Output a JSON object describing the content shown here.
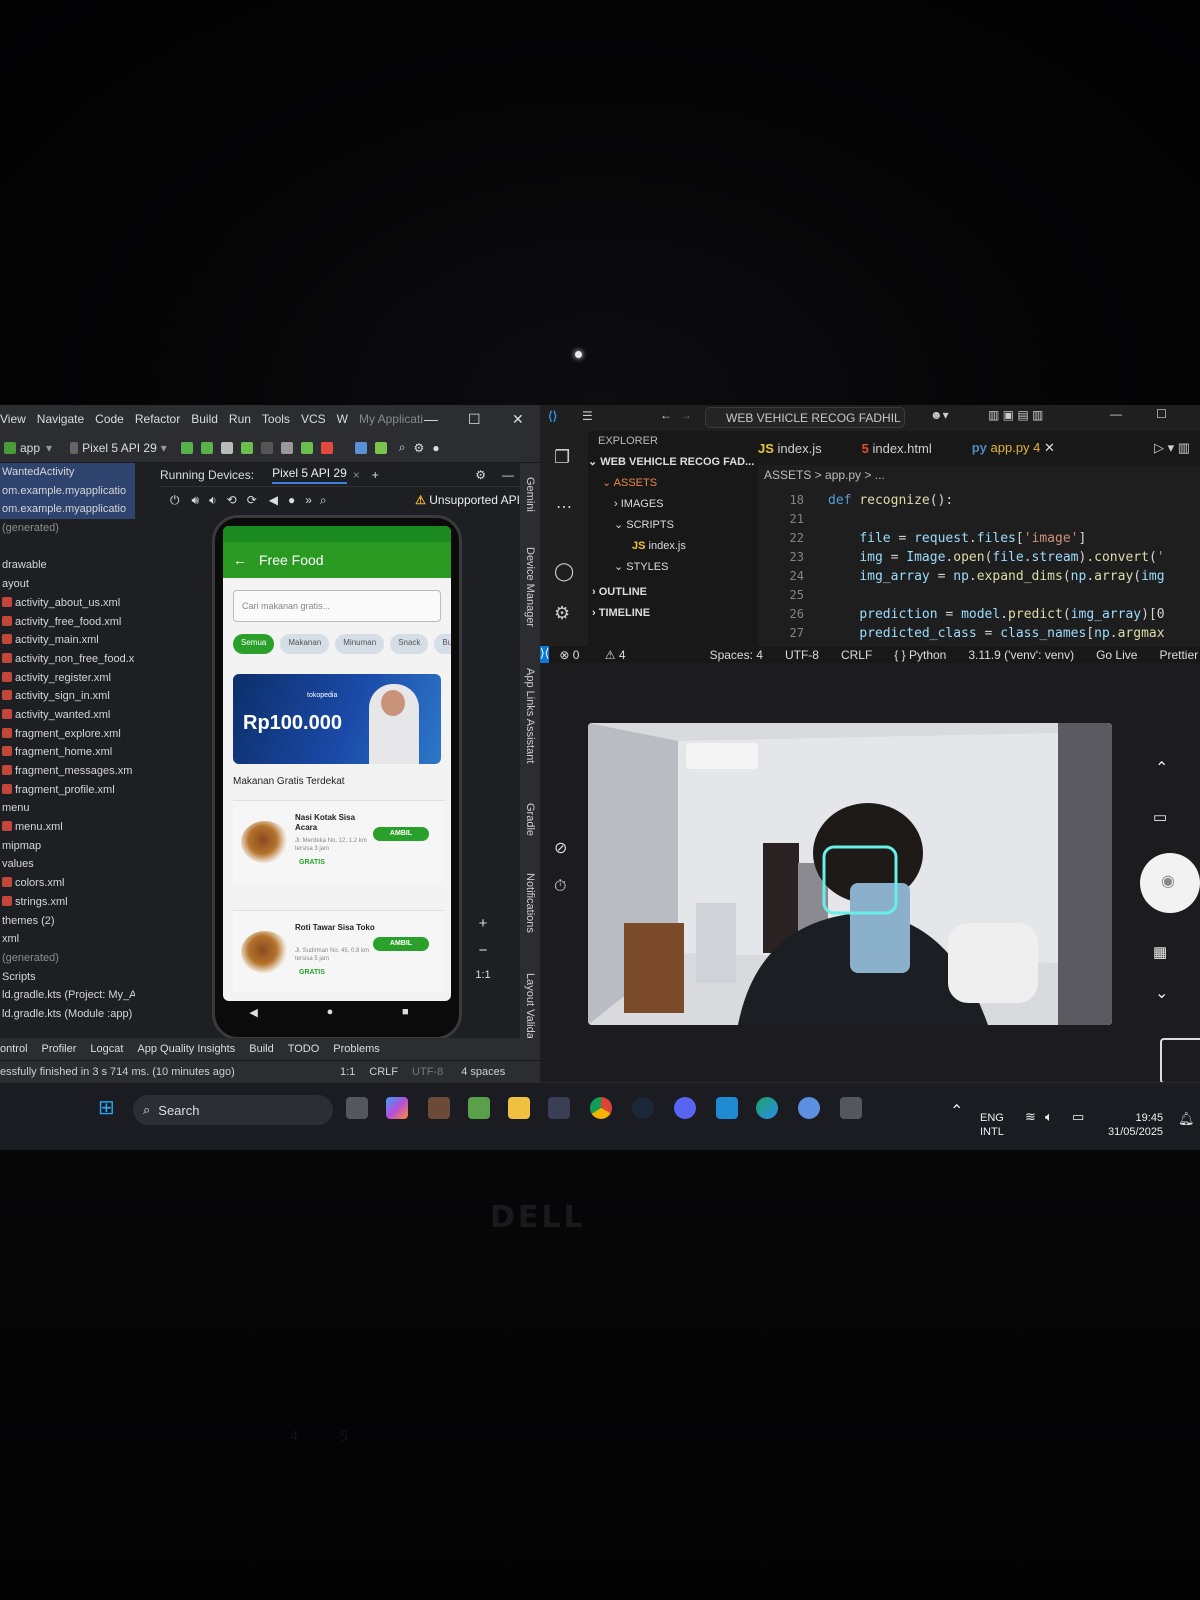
{
  "android_studio": {
    "menu": [
      "View",
      "Navigate",
      "Code",
      "Refactor",
      "Build",
      "Run",
      "Tools",
      "VCS",
      "W",
      "My Applicati"
    ],
    "run_config": "app",
    "device": "Pixel 5 API 29",
    "running_devices_label": "Running Devices:",
    "running_tab": "Pixel 5 API 29",
    "warning": "Unsupported API",
    "project_tree": [
      {
        "label": "WantedActivity",
        "kind": "file"
      },
      {
        "label": "om.example.myapplicatio",
        "kind": "pkg"
      },
      {
        "label": "om.example.myapplicatio",
        "kind": "pkg"
      },
      {
        "label": "(generated)",
        "kind": "gray"
      },
      {
        "label": "",
        "kind": "gap"
      },
      {
        "label": "drawable",
        "kind": "dir"
      },
      {
        "label": "ayout",
        "kind": "dir"
      },
      {
        "label": "activity_about_us.xml",
        "kind": "xml"
      },
      {
        "label": "activity_free_food.xml",
        "kind": "xml"
      },
      {
        "label": "activity_main.xml",
        "kind": "xml"
      },
      {
        "label": "activity_non_free_food.x",
        "kind": "xml"
      },
      {
        "label": "activity_register.xml",
        "kind": "xml"
      },
      {
        "label": "activity_sign_in.xml",
        "kind": "xml"
      },
      {
        "label": "activity_wanted.xml",
        "kind": "xml"
      },
      {
        "label": "fragment_explore.xml",
        "kind": "xml"
      },
      {
        "label": "fragment_home.xml",
        "kind": "xml"
      },
      {
        "label": "fragment_messages.xm",
        "kind": "xml"
      },
      {
        "label": "fragment_profile.xml",
        "kind": "xml"
      },
      {
        "label": "menu",
        "kind": "dir"
      },
      {
        "label": "menu.xml",
        "kind": "xml"
      },
      {
        "label": "mipmap",
        "kind": "dir"
      },
      {
        "label": "values",
        "kind": "dir"
      },
      {
        "label": "colors.xml",
        "kind": "xml"
      },
      {
        "label": "strings.xml",
        "kind": "xml"
      },
      {
        "label": "themes (2)",
        "kind": "dir"
      },
      {
        "label": "xml",
        "kind": "dir"
      },
      {
        "label": "(generated)",
        "kind": "gray"
      },
      {
        "label": "Scripts",
        "kind": "dir"
      },
      {
        "label": "ld.gradle.kts (Project: My_A",
        "kind": "file"
      },
      {
        "label": "ld.gradle.kts (Module :app)",
        "kind": "file"
      }
    ],
    "side_panels": [
      "Gemini",
      "Device Manager",
      "App Links Assistant",
      "Gradle",
      "Notifications",
      "Layout Validati"
    ],
    "bottom_tools": [
      "ontrol",
      "Profiler",
      "Logcat",
      "App Quality Insights",
      "Build",
      "TODO",
      "Problems"
    ],
    "status_message": "essfully finished in 3 s 714 ms. (10 minutes ago)",
    "status_right": [
      "1:1",
      "CRLF",
      "UTF-8",
      "4 spaces"
    ]
  },
  "phone_app": {
    "title": "Free Food",
    "search_placeholder": "Cari makanan gratis...",
    "chips": [
      "Semua",
      "Makanan",
      "Minuman",
      "Snack",
      "Bu"
    ],
    "banner": {
      "brand": "tokopedia",
      "amount": "Rp100.000"
    },
    "section_title": "Makanan Gratis Terdekat",
    "items": [
      {
        "title": "Nasi Kotak Sisa Acara",
        "address": "Jl. Merdeka No. 12, 1.2 km",
        "time": "tersisa 3 jam",
        "button": "AMBIL",
        "tag": "GRATIS"
      },
      {
        "title": "Roti Tawar Sisa Toko",
        "address": "Jl. Sudirman No. 45, 0.8 km",
        "time": "tersisa 5 jam",
        "button": "AMBIL",
        "tag": "GRATIS"
      }
    ],
    "zoom_controls": [
      "+",
      "−",
      "1:1"
    ]
  },
  "vscode": {
    "search": "WEB VEHICLE RECOG FADHIL",
    "explorer_header": "EXPLORER",
    "project": "WEB VEHICLE RECOG FAD...",
    "tree": [
      {
        "label": "ASSETS",
        "depth": 1,
        "color": "#e8894a"
      },
      {
        "label": "IMAGES",
        "depth": 2,
        "color": "#dddddd"
      },
      {
        "label": "SCRIPTS",
        "depth": 2,
        "color": "#dddddd"
      },
      {
        "label": "index.js",
        "depth": 3,
        "color": "#dddddd"
      },
      {
        "label": "STYLES",
        "depth": 2,
        "color": "#dddddd"
      }
    ],
    "outline": "OUTLINE",
    "timeline": "TIMELINE",
    "tabs": [
      {
        "label": "index.js",
        "icon": "JS"
      },
      {
        "label": "index.html",
        "icon": "5"
      },
      {
        "label": "app.py 4",
        "icon": "py"
      }
    ],
    "breadcrumb": "ASSETS > app.py > ...",
    "code": [
      {
        "ln": "18",
        "text": "def recognize():"
      },
      {
        "ln": "21",
        "text": ""
      },
      {
        "ln": "22",
        "text": "    file = request.files['image']"
      },
      {
        "ln": "23",
        "text": "    img = Image.open(file.stream).convert('"
      },
      {
        "ln": "24",
        "text": "    img_array = np.expand_dims(np.array(img"
      },
      {
        "ln": "25",
        "text": ""
      },
      {
        "ln": "26",
        "text": "    prediction = model.predict(img_array)[0"
      },
      {
        "ln": "27",
        "text": "    predicted_class = class_names[np.argmax"
      }
    ],
    "status": [
      "0",
      "4",
      "Spaces: 4",
      "UTF-8",
      "CRLF",
      "{ } Python",
      "3.11.9 ('venv': venv)",
      "Go Live",
      "Prettier"
    ]
  },
  "taskbar": {
    "search": "Search",
    "lang": "ENG",
    "layout": "INTL",
    "time": "19:45",
    "date": "31/05/2025"
  },
  "laptop": {
    "brand": "DELL"
  }
}
